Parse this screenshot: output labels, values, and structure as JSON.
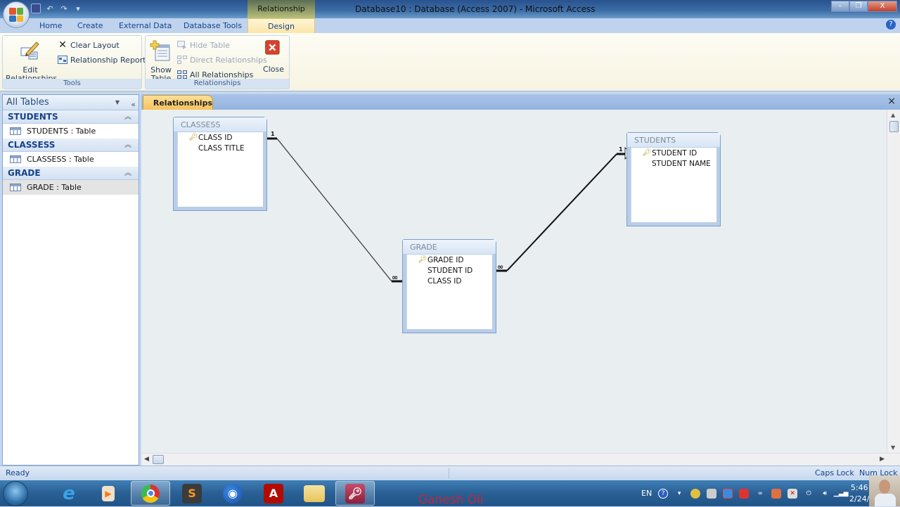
{
  "window": {
    "title": "Database10 : Database (Access 2007) - Microsoft Access",
    "context_tab_group": "Relationship Tools",
    "controls": {
      "minimize": "–",
      "restore": "❐",
      "close": "X"
    }
  },
  "quick_access": {
    "save": "save-icon",
    "undo": "↶",
    "redo": "↷",
    "customize": "▾"
  },
  "ribbon_tabs": [
    {
      "label": "Home",
      "active": false
    },
    {
      "label": "Create",
      "active": false
    },
    {
      "label": "External Data",
      "active": false
    },
    {
      "label": "Database Tools",
      "active": false
    },
    {
      "label": "Design",
      "active": true
    }
  ],
  "help_icon": "?",
  "ribbon": {
    "tools_group": {
      "label": "Tools",
      "edit_relationships": "Edit Relationships",
      "clear_layout": "Clear Layout",
      "relationship_report": "Relationship Report"
    },
    "relationships_group": {
      "label": "Relationships",
      "show_table_line1": "Show",
      "show_table_line2": "Table",
      "hide_table": "Hide Table",
      "direct_relationships": "Direct Relationships",
      "all_relationships": "All Relationships",
      "close": "Close"
    },
    "edit_relationships_line1": "Edit",
    "edit_relationships_line2": "Relationships"
  },
  "nav_pane": {
    "header": "All Tables",
    "groups": [
      {
        "name": "STUDENTS",
        "items": [
          {
            "label": "STUDENTS : Table",
            "selected": false
          }
        ]
      },
      {
        "name": "CLASSESS",
        "items": [
          {
            "label": "CLASSESS : Table",
            "selected": false
          }
        ]
      },
      {
        "name": "GRADE",
        "items": [
          {
            "label": "GRADE : Table",
            "selected": true
          }
        ]
      }
    ]
  },
  "document": {
    "tab_label": "Relationships",
    "close": "×"
  },
  "tables": [
    {
      "name": "CLASSESS",
      "fields": [
        {
          "name": "CLASS ID",
          "key": true
        },
        {
          "name": "CLASS TITLE",
          "key": false
        }
      ]
    },
    {
      "name": "GRADE",
      "fields": [
        {
          "name": "GRADE ID",
          "key": true
        },
        {
          "name": "STUDENT ID",
          "key": false
        },
        {
          "name": "CLASS ID",
          "key": false
        }
      ]
    },
    {
      "name": "STUDENTS",
      "fields": [
        {
          "name": "STUDENT ID",
          "key": true
        },
        {
          "name": "STUDENT NAME",
          "key": false
        }
      ]
    }
  ],
  "relationships": [
    {
      "from_table": "CLASSESS",
      "from_field": "CLASS ID",
      "from_card": "1",
      "to_table": "GRADE",
      "to_field": "CLASS ID",
      "to_card": "∞"
    },
    {
      "from_table": "STUDENTS",
      "from_field": "STUDENT ID",
      "from_card": "1",
      "to_table": "GRADE",
      "to_field": "STUDENT ID",
      "to_card": "∞"
    }
  ],
  "status_bar": {
    "left": "Ready",
    "caps_lock": "Caps Lock",
    "num_lock": "Num Lock"
  },
  "taskbar": {
    "apps": [
      "internet-explorer",
      "media-player",
      "chrome",
      "sublime-text",
      "firefox",
      "adobe-acrobat",
      "windows-explorer",
      "microsoft-access"
    ],
    "watermark": "Ganesh Oli",
    "language": "EN",
    "time": "5:46",
    "date": "2/24/"
  }
}
